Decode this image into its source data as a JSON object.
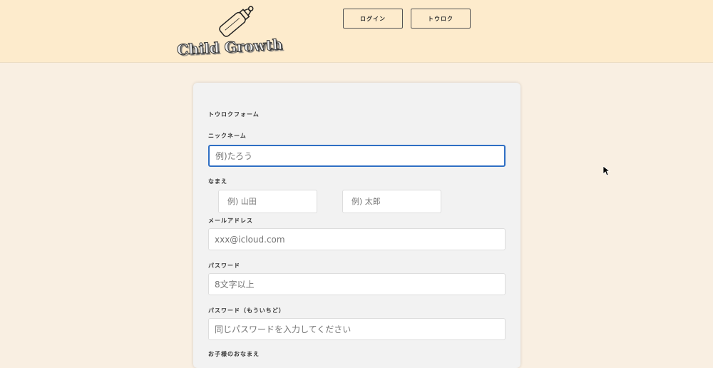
{
  "header": {
    "logo_text": "Child Growth",
    "login_label": "ログイン",
    "register_label": "トウロク"
  },
  "form": {
    "title": "トウロクフォーム",
    "nickname": {
      "label": "ニックネーム",
      "placeholder": "例)たろう"
    },
    "name": {
      "label": "なまえ",
      "last_placeholder": "例) 山田",
      "first_placeholder": "例) 太郎"
    },
    "email": {
      "label": "メールアドレス",
      "placeholder": "xxx@icloud.com"
    },
    "password": {
      "label": "パスワード",
      "placeholder": "8文字以上"
    },
    "password_confirm": {
      "label": "パスワード（もういちど）",
      "placeholder": "同じパスワードを入力してください"
    },
    "child_name": {
      "label": "お子様のおなまえ"
    }
  }
}
